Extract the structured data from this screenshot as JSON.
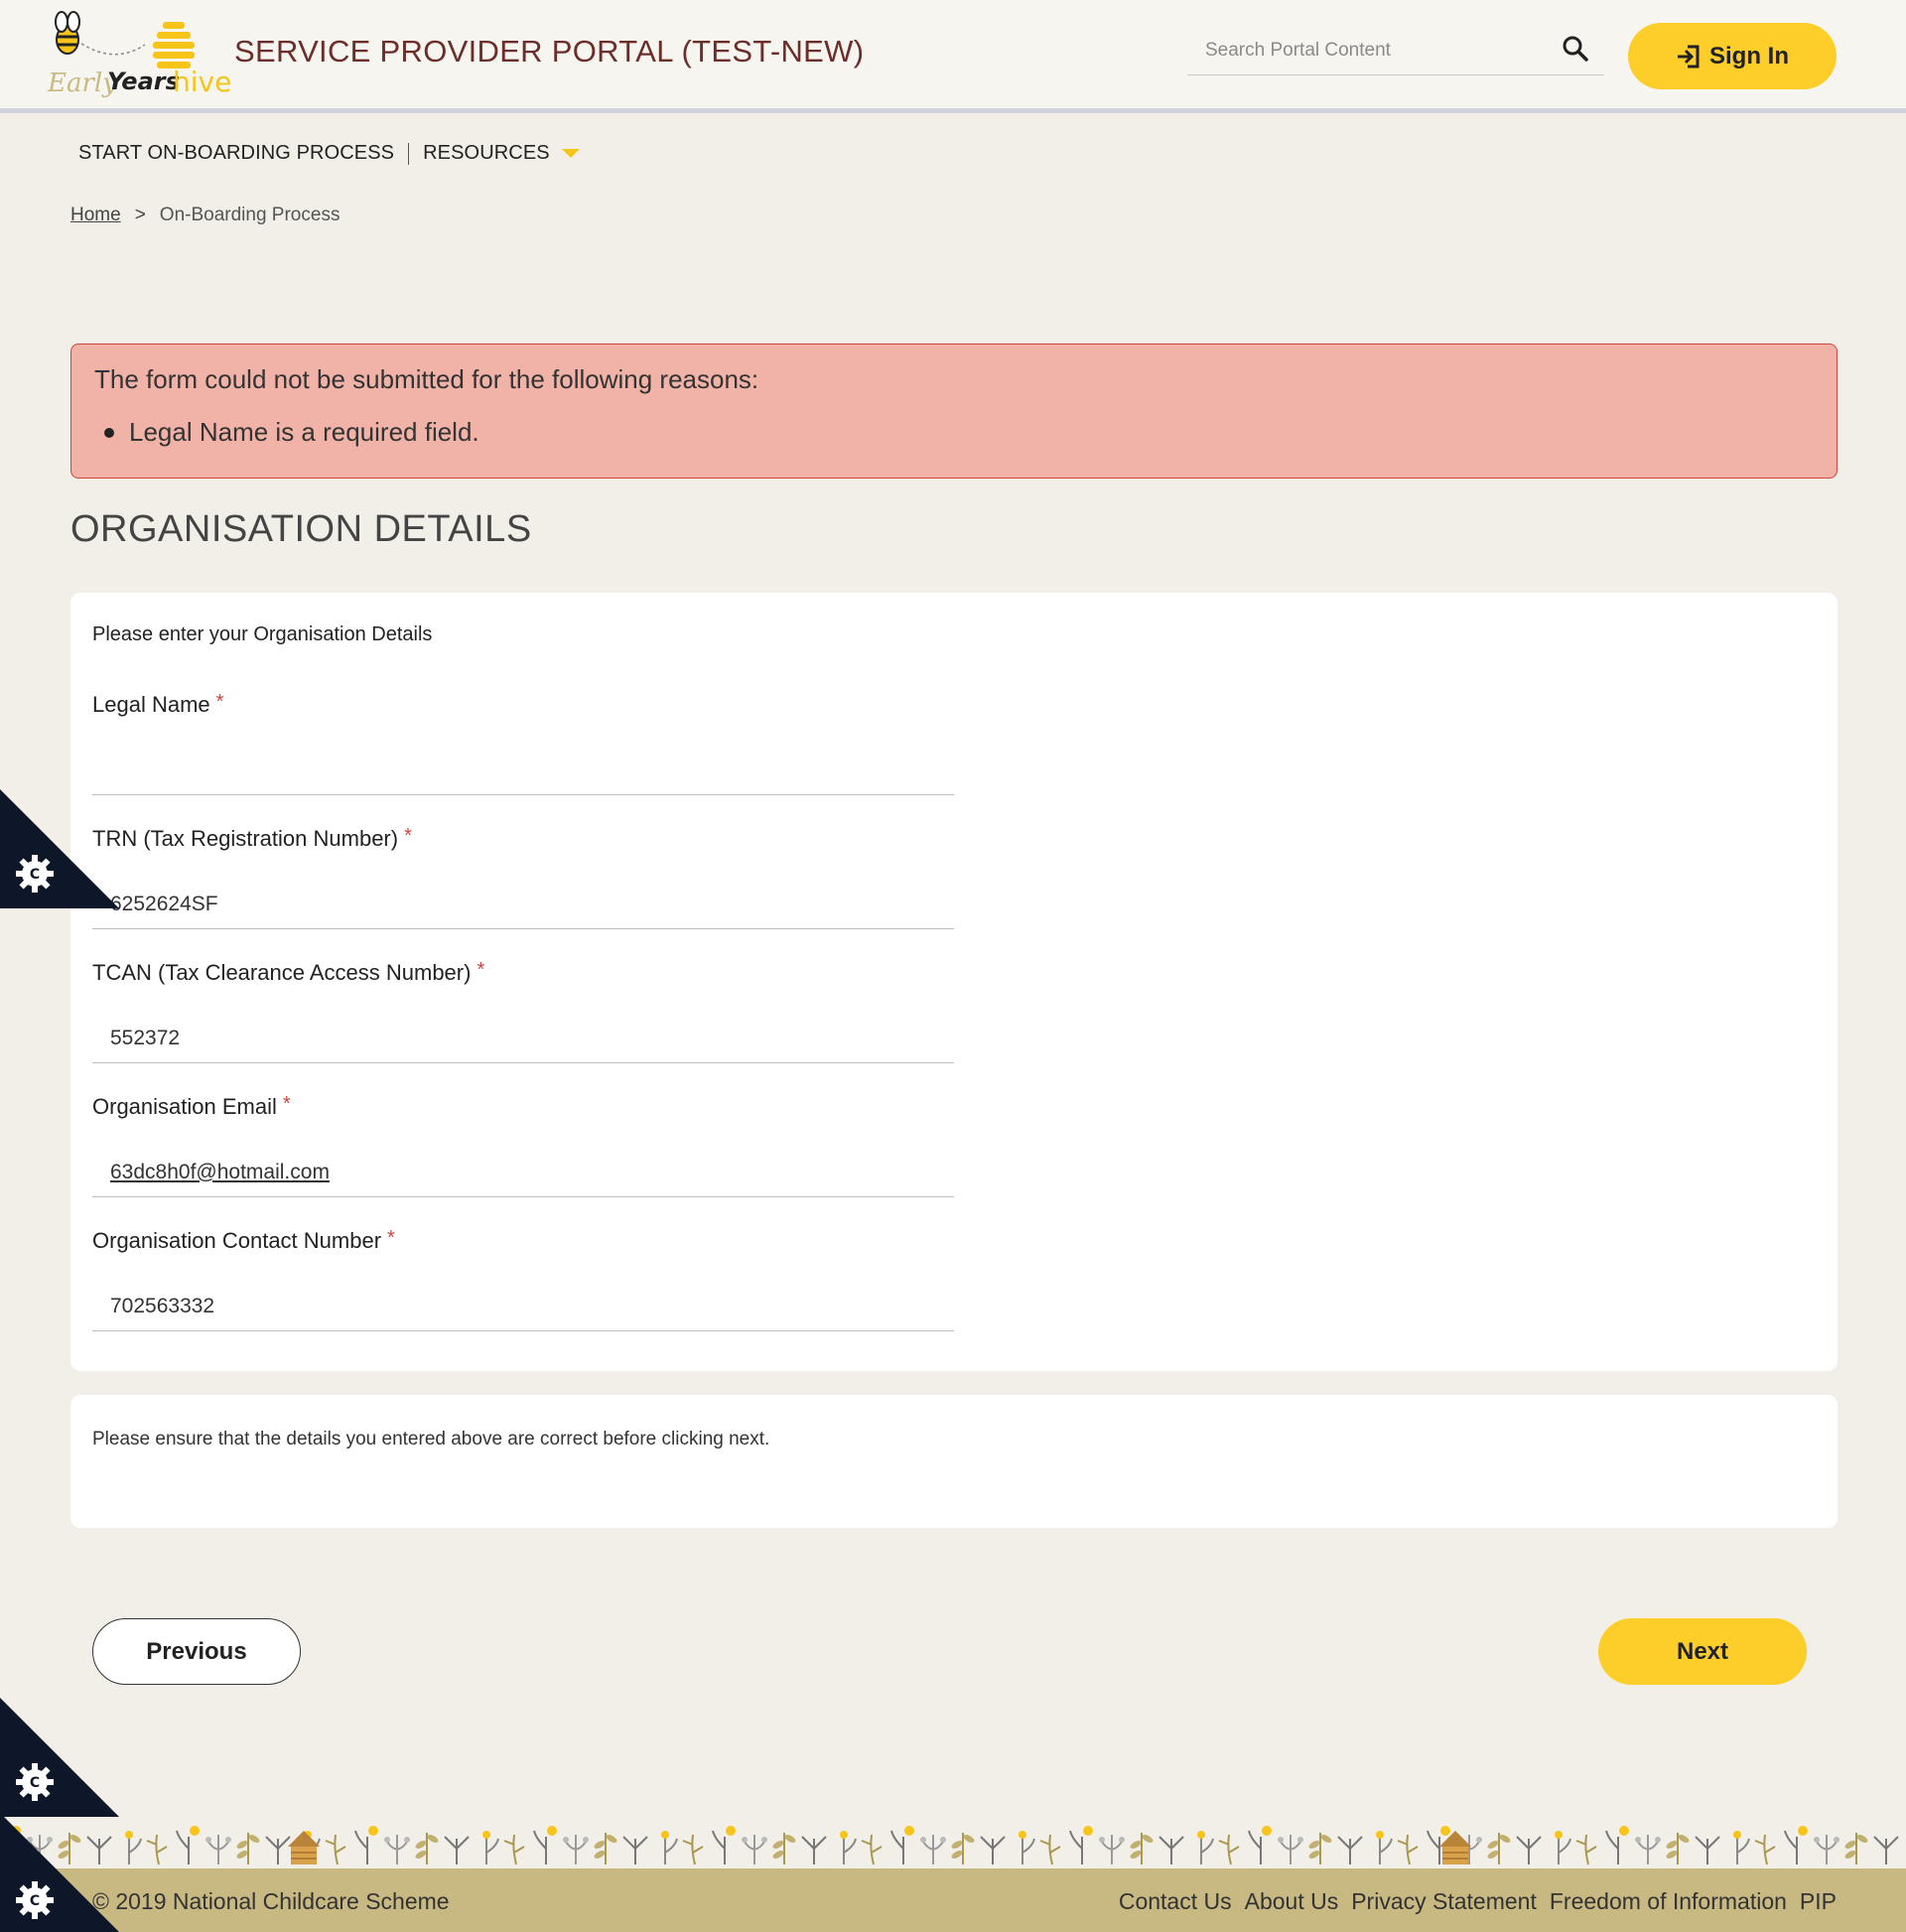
{
  "header": {
    "logo_text": "Early Years hive",
    "portal_title": "SERVICE PROVIDER PORTAL (TEST-NEW)",
    "search_placeholder": "Search Portal Content",
    "signin_label": "Sign In"
  },
  "nav": {
    "items": [
      {
        "label": "START ON-BOARDING PROCESS"
      },
      {
        "label": "RESOURCES"
      }
    ]
  },
  "breadcrumb": {
    "home": "Home",
    "separator": ">",
    "current": "On-Boarding Process"
  },
  "error": {
    "title": "The form could not be submitted for the following reasons:",
    "items": [
      "Legal Name is a required field."
    ]
  },
  "section_title": "ORGANISATION DETAILS",
  "form": {
    "intro": "Please enter your Organisation Details",
    "required_marker": "*",
    "fields": [
      {
        "label": "Legal Name",
        "value": ""
      },
      {
        "label": "TRN (Tax Registration Number)",
        "value": "6252624SF"
      },
      {
        "label": "TCAN (Tax Clearance Access Number)",
        "value": "552372"
      },
      {
        "label": "Organisation Email",
        "value": "63dc8h0f@hotmail.com"
      },
      {
        "label": "Organisation Contact Number",
        "value": "702563332"
      }
    ]
  },
  "notice": "Please ensure that the details you entered above are correct before clicking next.",
  "buttons": {
    "previous": "Previous",
    "next": "Next"
  },
  "footer": {
    "copyright": "2019 National Childcare Scheme",
    "links": [
      "Contact Us",
      "About Us",
      "Privacy Statement",
      "Freedom of Information",
      "PIP"
    ]
  },
  "colors": {
    "accent_yellow": "#fdcd2a",
    "error_bg": "#f1b3a8",
    "title_maroon": "#6b2e2a",
    "footer_bg": "#c8b882"
  }
}
